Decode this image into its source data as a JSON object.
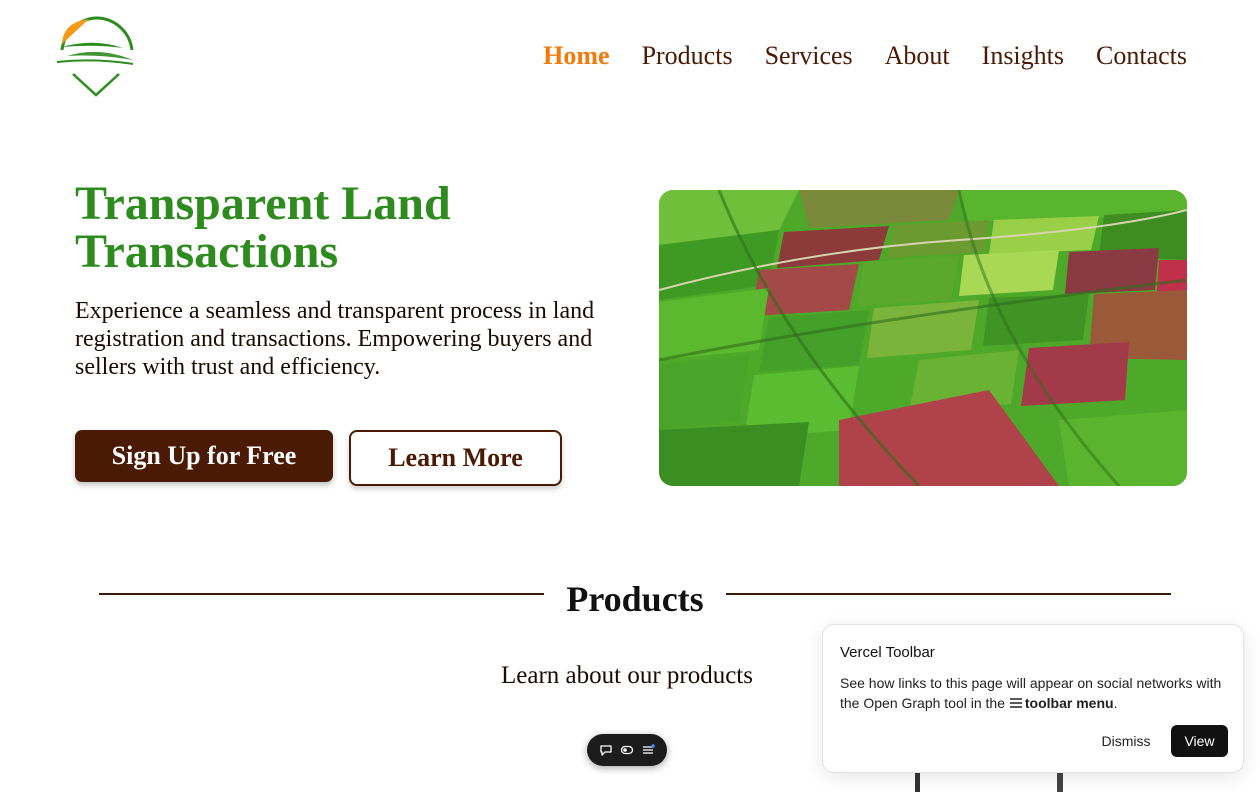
{
  "header": {
    "logo_icon": "land-sun-logo",
    "nav": [
      {
        "label": "Home",
        "active": true
      },
      {
        "label": "Products",
        "active": false
      },
      {
        "label": "Services",
        "active": false
      },
      {
        "label": "About",
        "active": false
      },
      {
        "label": "Insights",
        "active": false
      },
      {
        "label": "Contacts",
        "active": false
      }
    ]
  },
  "hero": {
    "title": "Transparent Land Transactions",
    "subtitle": "Experience a seamless and transparent process in land registration and transactions. Empowering buyers and sellers with trust and efficiency.",
    "primary_button": "Sign Up for Free",
    "secondary_button": "Learn More",
    "image": "aerial-farmland-photo"
  },
  "products": {
    "title": "Products",
    "subtitle": "Learn about our products"
  },
  "mini_toolbar": {
    "icons": [
      "comment-icon",
      "toggle-icon",
      "menu-icon"
    ]
  },
  "vercel_popup": {
    "title": "Vercel Toolbar",
    "body_prefix": "See how links to this page will appear on social networks with the Open Graph tool in the",
    "body_bold": "toolbar menu",
    "body_suffix": ".",
    "dismiss_label": "Dismiss",
    "view_label": "View"
  },
  "colors": {
    "brand_green": "#2e8b1e",
    "brand_brown": "#4b1a04",
    "accent_orange": "#f07a0a"
  }
}
